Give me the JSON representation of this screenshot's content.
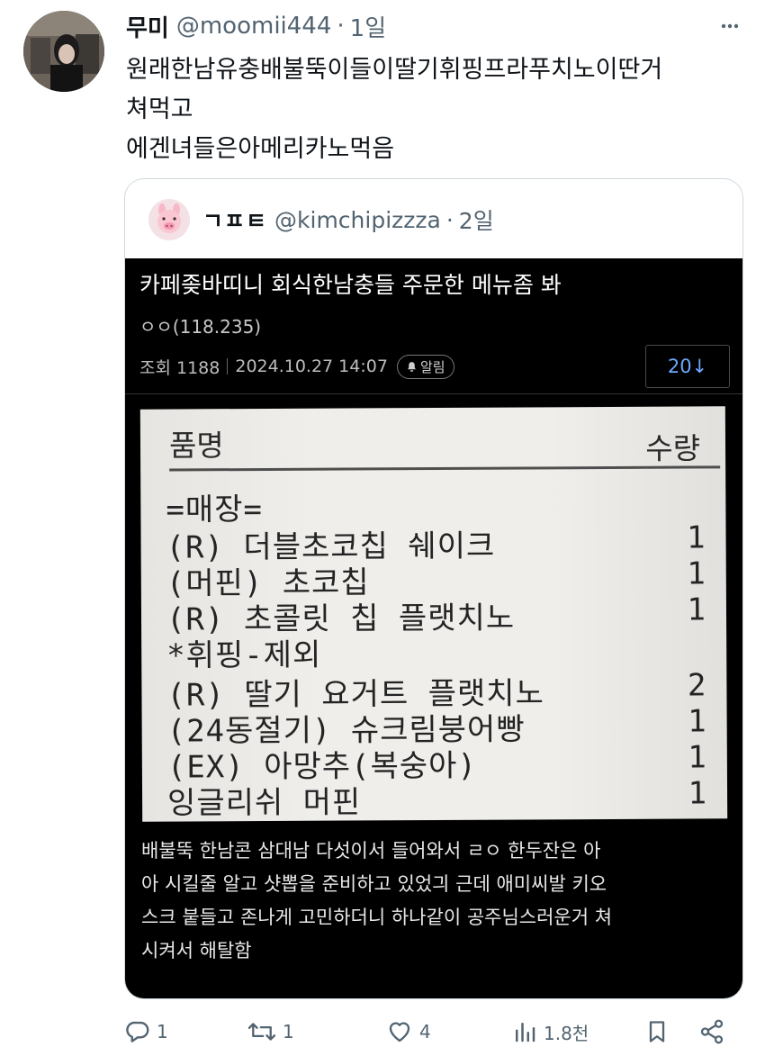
{
  "tweet": {
    "author": {
      "display_name": "무미",
      "handle": "@moomii444",
      "separator": "·",
      "time": "1일"
    },
    "lines": [
      "원래한남유충배불뚝이들이딸기휘핑프라푸치노이딴거",
      "쳐먹고",
      "에겐녀들은아메리카노먹음"
    ]
  },
  "quote": {
    "author": {
      "display_name": "ㄱㅍㅌ",
      "handle": "@kimchipizzza",
      "separator": "·",
      "time": "2일"
    },
    "post": {
      "title": "카페좆바띠니 회식한남충들 주문한 메뉴좀 봐",
      "author": "ㅇㅇ(118.235)",
      "views_label": "조회 1188",
      "datetime": "2024.10.27 14:07",
      "alarm_label": "알림",
      "comment_count": "20↓"
    },
    "receipt": {
      "header_name": "품명",
      "header_qty": "수량",
      "rows": [
        {
          "name": "=매장=",
          "qty": ""
        },
        {
          "name": "(R) 더블초코칩 쉐이크",
          "qty": "1"
        },
        {
          "name": "(머핀) 초코칩",
          "qty": "1"
        },
        {
          "name": "(R) 초콜릿 칩 플랫치노",
          "qty": "1"
        },
        {
          "name": " *휘핑-제외",
          "qty": ""
        },
        {
          "name": "(R) 딸기 요거트 플랫치노",
          "qty": "2"
        },
        {
          "name": "(24동절기) 슈크림붕어빵",
          "qty": "1"
        },
        {
          "name": "(EX) 아망추(복숭아)",
          "qty": "1"
        },
        {
          "name": "잉글리쉬 머핀",
          "qty": "1"
        }
      ]
    },
    "body_lines": [
      "배불뚝 한남콘 삼대남 다섯이서 들어와서 ㄹㅇ 한두잔은 아",
      "아 시킬줄 알고 샷뽑을 준비하고 있었긔 근데 애미씨발 키오",
      "스크 붙들고 존나게 고민하더니 하나같이 공주님스러운거 쳐",
      "시켜서 해탈함"
    ]
  },
  "actions": {
    "replies": "1",
    "retweets": "1",
    "likes": "4",
    "views": "1.8천"
  },
  "icons": [
    "more-icon",
    "reply-icon",
    "retweet-icon",
    "like-icon",
    "views-icon",
    "bookmark-icon",
    "share-icon",
    "bell-icon"
  ],
  "colors": {
    "text": "#0f1419",
    "secondary": "#536471",
    "border": "#cfd9de",
    "media_bg": "#000000",
    "link_blue": "#6ea8ff"
  }
}
